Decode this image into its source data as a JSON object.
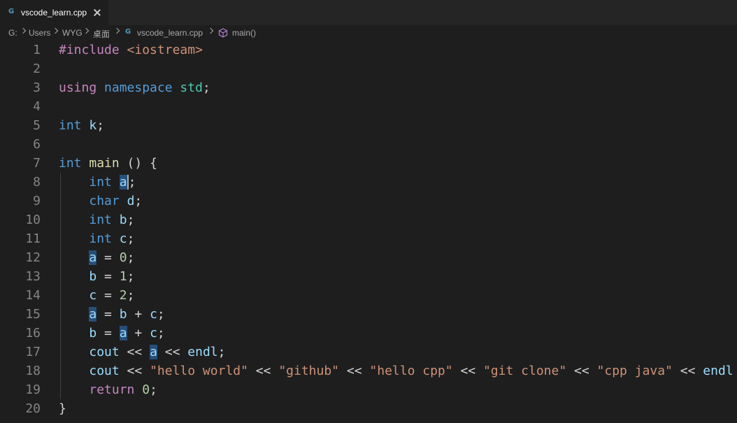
{
  "tab": {
    "icon": "cpp-file-icon",
    "icon_glyph": "G",
    "filename": "vscode_learn.cpp",
    "active": true
  },
  "breadcrumb": {
    "items": [
      "G:",
      "Users",
      "WYG",
      "桌面",
      "vscode_learn.cpp",
      "main()"
    ],
    "file_icon": "cpp-file-icon",
    "symbol_icon": "cube-method-icon"
  },
  "editor": {
    "language": "cpp",
    "highlighted_symbol": "a",
    "lines": [
      {
        "n": "1",
        "tokens": [
          [
            "pp",
            "#include"
          ],
          [
            "p",
            " "
          ],
          [
            "inc",
            "<iostream>"
          ]
        ]
      },
      {
        "n": "2",
        "tokens": []
      },
      {
        "n": "3",
        "tokens": [
          [
            "ctl",
            "using"
          ],
          [
            "p",
            " "
          ],
          [
            "kw",
            "namespace"
          ],
          [
            "p",
            " "
          ],
          [
            "ns",
            "std"
          ],
          [
            "p",
            ";"
          ]
        ]
      },
      {
        "n": "4",
        "tokens": []
      },
      {
        "n": "5",
        "tokens": [
          [
            "kw",
            "int"
          ],
          [
            "p",
            " "
          ],
          [
            "var",
            "k"
          ],
          [
            "p",
            ";"
          ]
        ]
      },
      {
        "n": "6",
        "tokens": []
      },
      {
        "n": "7",
        "tokens": [
          [
            "kw",
            "int"
          ],
          [
            "p",
            " "
          ],
          [
            "fn",
            "main"
          ],
          [
            "p",
            " () {"
          ]
        ]
      },
      {
        "n": "8",
        "tokens": [
          [
            "p",
            "    "
          ],
          [
            "kw",
            "int"
          ],
          [
            "p",
            " "
          ],
          [
            "varhl-cursor",
            "a"
          ],
          [
            "p",
            ";"
          ]
        ]
      },
      {
        "n": "9",
        "tokens": [
          [
            "p",
            "    "
          ],
          [
            "kw",
            "char"
          ],
          [
            "p",
            " "
          ],
          [
            "var",
            "d"
          ],
          [
            "p",
            ";"
          ]
        ]
      },
      {
        "n": "10",
        "tokens": [
          [
            "p",
            "    "
          ],
          [
            "kw",
            "int"
          ],
          [
            "p",
            " "
          ],
          [
            "var",
            "b"
          ],
          [
            "p",
            ";"
          ]
        ]
      },
      {
        "n": "11",
        "tokens": [
          [
            "p",
            "    "
          ],
          [
            "kw",
            "int"
          ],
          [
            "p",
            " "
          ],
          [
            "var",
            "c"
          ],
          [
            "p",
            ";"
          ]
        ]
      },
      {
        "n": "12",
        "tokens": [
          [
            "p",
            "    "
          ],
          [
            "varhl",
            "a"
          ],
          [
            "p",
            " = "
          ],
          [
            "num",
            "0"
          ],
          [
            "p",
            ";"
          ]
        ]
      },
      {
        "n": "13",
        "tokens": [
          [
            "p",
            "    "
          ],
          [
            "var",
            "b"
          ],
          [
            "p",
            " = "
          ],
          [
            "num",
            "1"
          ],
          [
            "p",
            ";"
          ]
        ]
      },
      {
        "n": "14",
        "tokens": [
          [
            "p",
            "    "
          ],
          [
            "var",
            "c"
          ],
          [
            "p",
            " = "
          ],
          [
            "num",
            "2"
          ],
          [
            "p",
            ";"
          ]
        ]
      },
      {
        "n": "15",
        "tokens": [
          [
            "p",
            "    "
          ],
          [
            "varhl",
            "a"
          ],
          [
            "p",
            " = "
          ],
          [
            "var",
            "b"
          ],
          [
            "p",
            " + "
          ],
          [
            "var",
            "c"
          ],
          [
            "p",
            ";"
          ]
        ]
      },
      {
        "n": "16",
        "tokens": [
          [
            "p",
            "    "
          ],
          [
            "var",
            "b"
          ],
          [
            "p",
            " = "
          ],
          [
            "varhl",
            "a"
          ],
          [
            "p",
            " + "
          ],
          [
            "var",
            "c"
          ],
          [
            "p",
            ";"
          ]
        ]
      },
      {
        "n": "17",
        "tokens": [
          [
            "p",
            "    "
          ],
          [
            "var",
            "cout"
          ],
          [
            "p",
            " << "
          ],
          [
            "varhl",
            "a"
          ],
          [
            "p",
            " << "
          ],
          [
            "var",
            "endl"
          ],
          [
            "p",
            ";"
          ]
        ]
      },
      {
        "n": "18",
        "tokens": [
          [
            "p",
            "    "
          ],
          [
            "var",
            "cout"
          ],
          [
            "p",
            " << "
          ],
          [
            "str",
            "\"hello world\""
          ],
          [
            "p",
            " << "
          ],
          [
            "str",
            "\"github\""
          ],
          [
            "p",
            " << "
          ],
          [
            "str",
            "\"hello cpp\""
          ],
          [
            "p",
            " << "
          ],
          [
            "str",
            "\"git clone\""
          ],
          [
            "p",
            " << "
          ],
          [
            "str",
            "\"cpp java\""
          ],
          [
            "p",
            " << "
          ],
          [
            "var",
            "endl"
          ]
        ]
      },
      {
        "n": "19",
        "tokens": [
          [
            "p",
            "    "
          ],
          [
            "ctl",
            "return"
          ],
          [
            "p",
            " "
          ],
          [
            "num",
            "0"
          ],
          [
            "p",
            ";"
          ]
        ]
      },
      {
        "n": "20",
        "tokens": [
          [
            "p",
            "}"
          ]
        ]
      }
    ],
    "indent_guide_lines": [
      "8",
      "9",
      "10",
      "11",
      "12",
      "13",
      "14",
      "15",
      "16",
      "17",
      "18",
      "19"
    ]
  },
  "colors": {
    "background": "#1e1e1e",
    "tabbar": "#252526",
    "keyword": "#569cd6",
    "control": "#c586c0",
    "string": "#ce9178",
    "number": "#b5cea8",
    "variable": "#9cdcfe",
    "function": "#dcdcaa",
    "namespace": "#4ec9b0",
    "line_number": "#858585",
    "highlight": "#264f78"
  }
}
